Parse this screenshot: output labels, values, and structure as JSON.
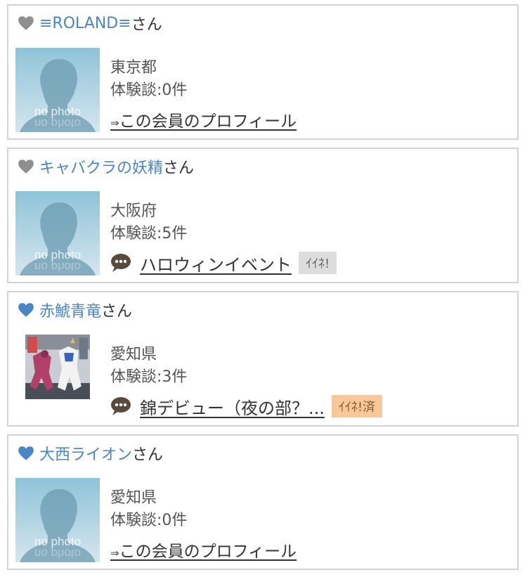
{
  "colors": {
    "accent": "#4a86c5",
    "heart_gray": "#8f8f8f",
    "heart_blue": "#4a86c5",
    "like_bg": "#dddddd",
    "liked_bg": "#f7c89a"
  },
  "members": [
    {
      "name": "≡ROLAND≡",
      "suffix": "さん",
      "heart": "gray",
      "photo": "no photo",
      "prefecture": "東京都",
      "reviews": "体験談:0件",
      "link": {
        "arrow": "⇒",
        "text": "この会員のプロフィール"
      }
    },
    {
      "name": "キャバクラの妖精",
      "suffix": "さん",
      "heart": "gray",
      "photo": "no photo",
      "prefecture": "大阪府",
      "reviews": "体験談:5件",
      "review_title": "ハロウィンイベント",
      "like_label": "ｲｲﾈ!"
    },
    {
      "name": "赤鯱青竜",
      "suffix": "さん",
      "heart": "blue",
      "photo": "robot-figures-photo",
      "prefecture": "愛知県",
      "reviews": "体験談:3件",
      "review_title": "錦デビュー（夜の部？...",
      "like_label": "ｲｲﾈ!済"
    },
    {
      "name": "大西ライオン",
      "suffix": "さん",
      "heart": "blue",
      "photo": "no photo",
      "prefecture": "愛知県",
      "reviews": "体験談:0件",
      "link": {
        "arrow": "⇒",
        "text": "この会員のプロフィール"
      }
    }
  ]
}
